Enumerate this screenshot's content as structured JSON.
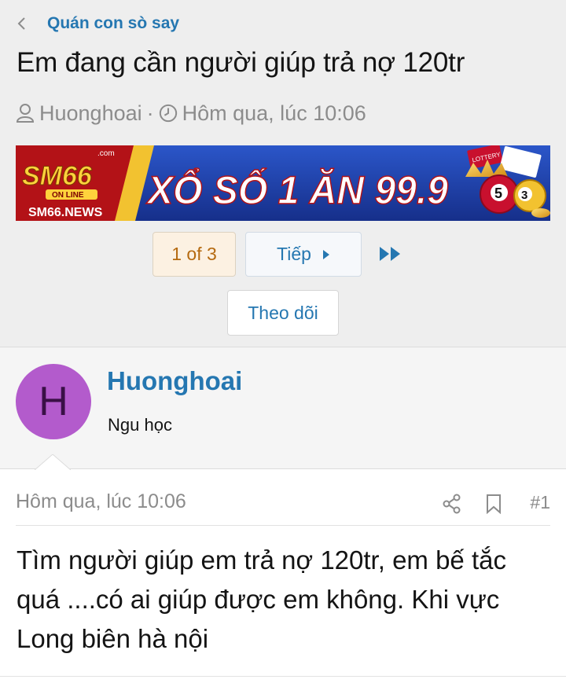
{
  "breadcrumb": {
    "label": "Quán con sò say",
    "icon": "chevron-left-icon"
  },
  "thread": {
    "title": "Em đang cần người giúp trả nợ 120tr",
    "author": "Huonghoai",
    "separator": "·",
    "date": "Hôm qua, lúc 10:06"
  },
  "banner": {
    "logo_top": ".com",
    "logo_main": "SM66",
    "logo_sub": "ON LINE",
    "logo_site": "SM66.NEWS",
    "headline": "XỔ SỐ 1 ĂN 99.9",
    "lottery_text": "LOTTERY",
    "ball_left": "5",
    "ball_right": "3"
  },
  "pagination": {
    "current": "1 of 3",
    "next_label": "Tiếp",
    "last_icon": "double-chevron-right-icon"
  },
  "follow_label": "Theo dõi",
  "post": {
    "avatar_letter": "H",
    "username": "Huonghoai",
    "user_title": "Ngu học",
    "date": "Hôm qua, lúc 10:06",
    "number": "#1",
    "body": "Tìm người giúp em trả nợ 120tr, em bế tắc quá ....có ai giúp được em không. Khi vực Long biên hà nội"
  },
  "colors": {
    "link": "#2577b1",
    "header_bg": "#eeeeee",
    "avatar_bg": "#b35bcc",
    "current_page_bg": "#fcf1e2",
    "banner_red": "#b31217",
    "banner_blue": "#1c3ea8"
  }
}
